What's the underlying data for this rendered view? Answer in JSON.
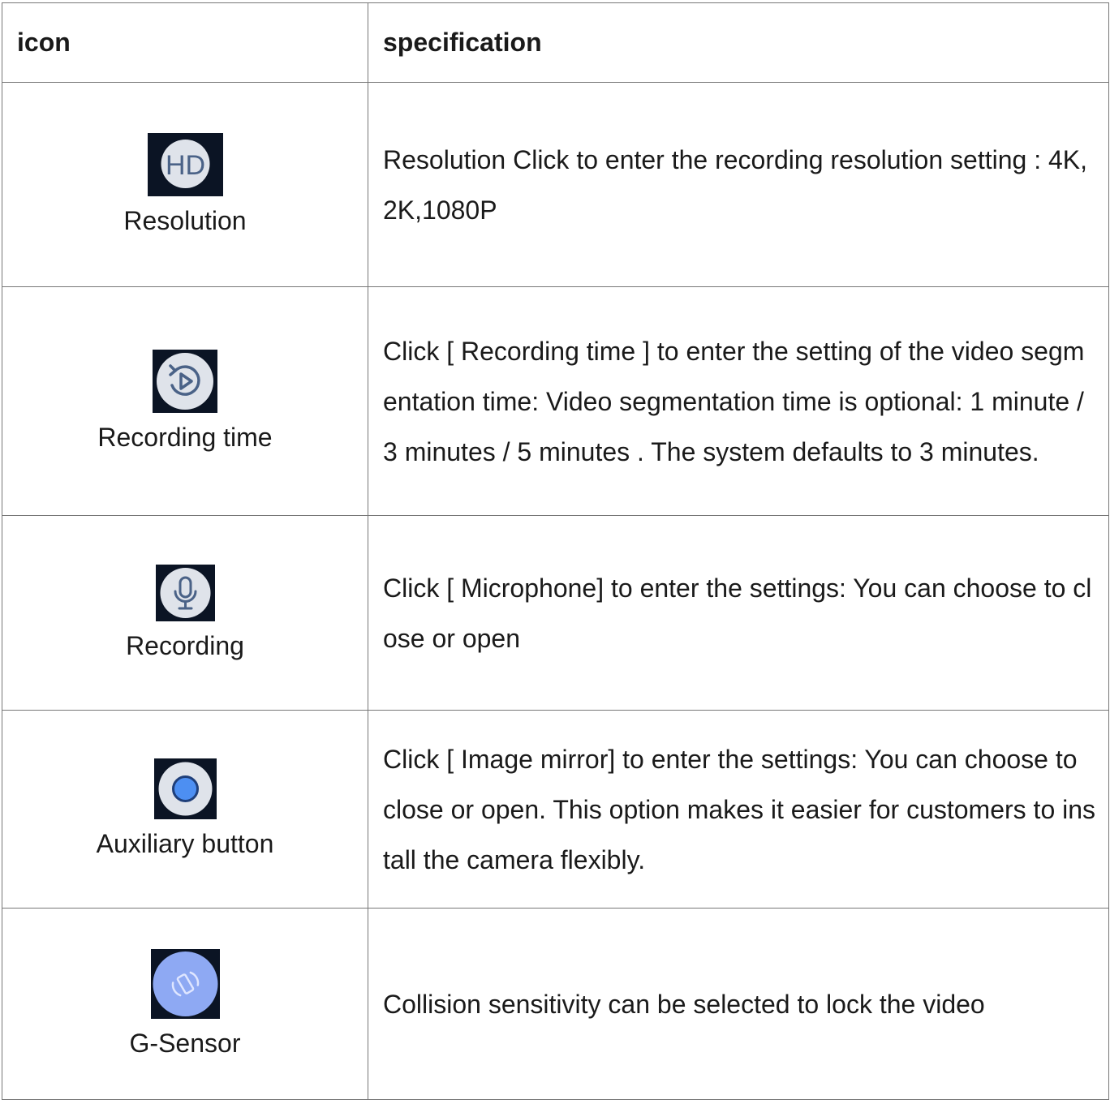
{
  "table": {
    "headers": {
      "icon": "icon",
      "spec": "specification"
    },
    "rows": [
      {
        "icon": "hd-icon",
        "icon_text": "HD",
        "label": "Resolution",
        "spec": "Resolution  Click to enter the recording resolution setting : 4K,2K,1080P"
      },
      {
        "icon": "replay-timer-icon",
        "label": "Recording time",
        "spec": "Click [ Recording time ] to enter the setting of the video segmentation time: Video segmentation time is optional: 1 minute / 3 minutes / 5 minutes . The system defaults to 3 minutes."
      },
      {
        "icon": "microphone-icon",
        "label": "Recording",
        "spec": "Click [ Microphone] to enter the settings: You can choose to close or open"
      },
      {
        "icon": "record-dot-icon",
        "label": "Auxiliary button",
        "spec": "Click [ Image mirror] to enter the settings: You can choose to close or open. This option makes it easier for customers to install the camera flexibly."
      },
      {
        "icon": "rotate-sensor-icon",
        "label": "G-Sensor",
        "spec": "Collision sensitivity can be selected to lock the video"
      }
    ]
  },
  "colors": {
    "tile_background": "#0b1424",
    "icon_circle": "#dfe3ea",
    "icon_glyph": "#4a6287",
    "accent_blue": "#4d8ff2",
    "gsensor_circle": "#8ea9f3",
    "border": "#777777"
  }
}
